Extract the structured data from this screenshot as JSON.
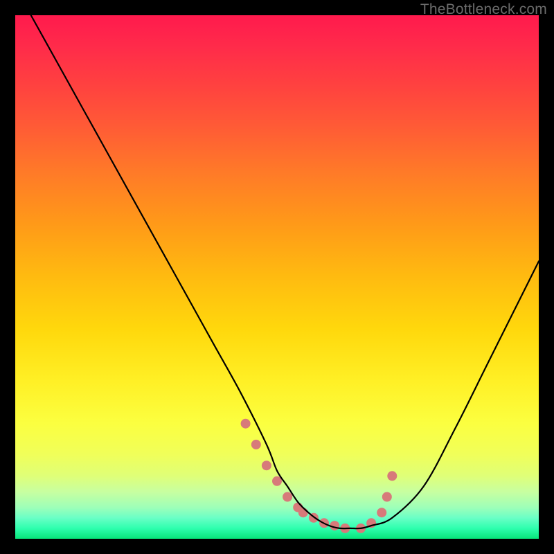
{
  "attribution": "TheBottleneck.com",
  "chart_data": {
    "type": "line",
    "title": "",
    "xlabel": "",
    "ylabel": "",
    "xlim": [
      0,
      100
    ],
    "ylim": [
      0,
      100
    ],
    "grid": false,
    "legend": false,
    "series": [
      {
        "name": "bottleneck-curve",
        "x": [
          3,
          8,
          13,
          18,
          23,
          28,
          33,
          38,
          43,
          48,
          50,
          52,
          54,
          56,
          58,
          60,
          62,
          64,
          66,
          68,
          72,
          78,
          84,
          90,
          96,
          100
        ],
        "y": [
          100,
          91,
          82,
          73,
          64,
          55,
          46,
          37,
          28,
          18,
          13,
          10,
          7,
          5,
          3.5,
          2.5,
          2,
          2,
          2,
          2.5,
          4,
          10,
          21,
          33,
          45,
          53
        ]
      }
    ],
    "markers": {
      "name": "near-optimum-dots",
      "x": [
        44,
        46,
        48,
        50,
        52,
        54,
        55,
        57,
        59,
        61,
        63,
        66,
        68,
        70,
        71,
        72
      ],
      "y": [
        22,
        18,
        14,
        11,
        8,
        6,
        5,
        4,
        3,
        2.5,
        2,
        2,
        3,
        5,
        8,
        12
      ]
    }
  }
}
